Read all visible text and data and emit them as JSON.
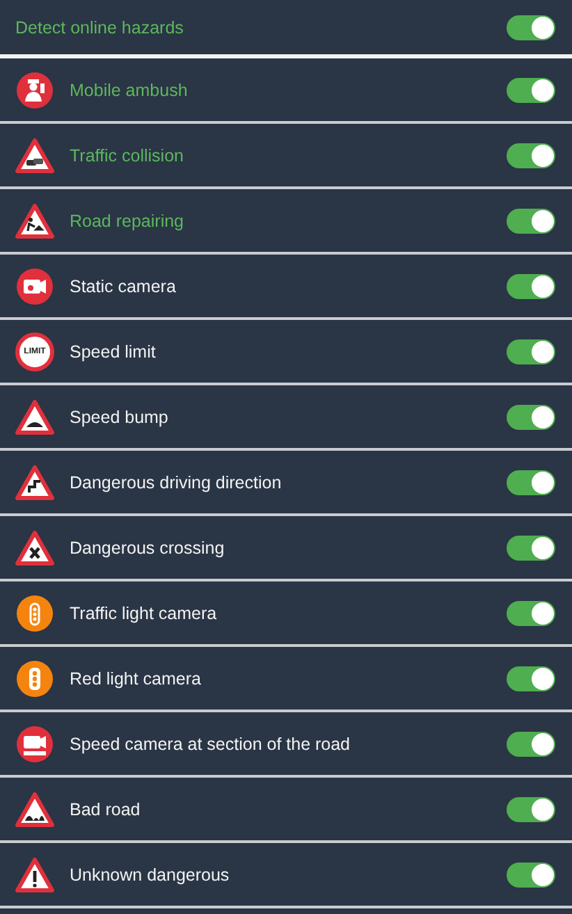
{
  "master": {
    "label": "Detect online hazards",
    "on": true,
    "highlighted": true
  },
  "hazards": [
    {
      "kind": "police",
      "label": "Mobile ambush",
      "on": true,
      "highlighted": true
    },
    {
      "kind": "collision",
      "label": "Traffic collision",
      "on": true,
      "highlighted": true
    },
    {
      "kind": "roadwork",
      "label": "Road repairing",
      "on": true,
      "highlighted": true
    },
    {
      "kind": "camera",
      "label": "Static camera",
      "on": true,
      "highlighted": false
    },
    {
      "kind": "limit",
      "label": "Speed limit",
      "sign_text": "LIMIT",
      "on": true,
      "highlighted": false
    },
    {
      "kind": "bump",
      "label": "Speed bump",
      "on": true,
      "highlighted": false
    },
    {
      "kind": "curve",
      "label": "Dangerous driving direction",
      "on": true,
      "highlighted": false
    },
    {
      "kind": "crossing",
      "label": "Dangerous crossing",
      "on": true,
      "highlighted": false
    },
    {
      "kind": "traffic-light-camera",
      "label": "Traffic light camera",
      "on": true,
      "highlighted": false
    },
    {
      "kind": "red-light",
      "label": "Red light camera",
      "on": true,
      "highlighted": false
    },
    {
      "kind": "section-camera",
      "label": "Speed camera at section of the road",
      "on": true,
      "highlighted": false
    },
    {
      "kind": "bad-road",
      "label": "Bad road",
      "on": true,
      "highlighted": false
    },
    {
      "kind": "warning",
      "label": "Unknown dangerous",
      "on": true,
      "highlighted": false
    }
  ]
}
